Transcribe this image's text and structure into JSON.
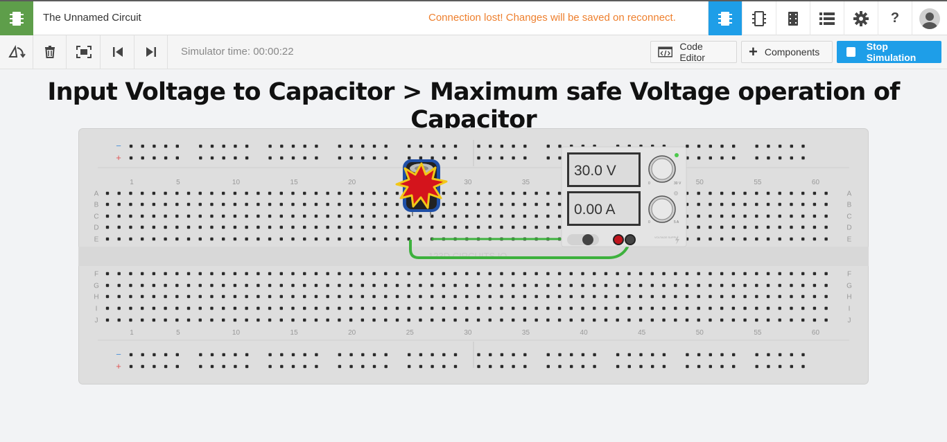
{
  "app": {
    "title": "The Unnamed Circuit",
    "status": "Connection lost! Changes will be saved on reconnect."
  },
  "topnav": {
    "icons": [
      "circuit-view-icon",
      "component-list-icon",
      "schematic-icon",
      "bom-list-icon",
      "gear-icon",
      "help-icon",
      "avatar-icon"
    ],
    "help_label": "?"
  },
  "toolbar": {
    "sim_time": "Simulator time: 00:00:22",
    "code_editor": "Code Editor",
    "components": "Components",
    "stop": "Stop Simulation",
    "components_plus": "+"
  },
  "heading": "Input Voltage to Capacitor > Maximum safe Voltage operation of Capacitor",
  "breadboard": {
    "column_numbers": [
      "1",
      "5",
      "10",
      "15",
      "20",
      "25",
      "30",
      "35",
      "40",
      "45",
      "50",
      "55",
      "60"
    ],
    "rows_top": [
      "A",
      "B",
      "C",
      "D",
      "E"
    ],
    "rows_bottom": [
      "F",
      "G",
      "H",
      "I",
      "J"
    ],
    "rail_minus": "−",
    "rail_plus": "+",
    "watermark": "123D CIRCUITS.IO"
  },
  "power_supply": {
    "voltage": "30.0 V",
    "current": "0.00 A",
    "label": "VOLTAGE SUPPLY",
    "v_max": "30 V",
    "a_max": "5 A",
    "knob_min": "0"
  },
  "colors": {
    "accent": "#1e9ee8",
    "brand": "#5e9e4a",
    "warning": "#ee7f2d",
    "wire": "#3db13d"
  }
}
